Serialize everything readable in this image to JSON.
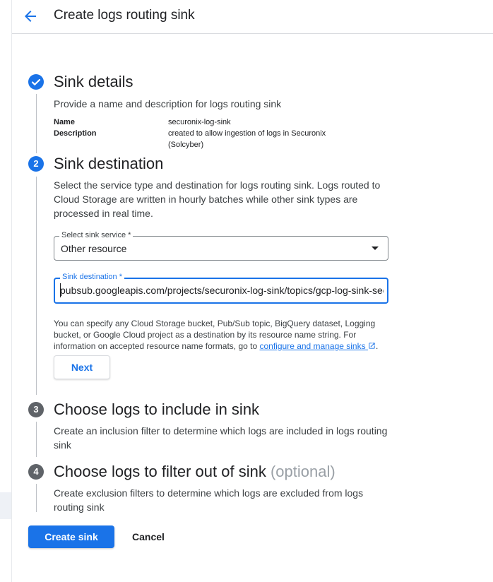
{
  "header": {
    "title": "Create logs routing sink",
    "back_icon": "arrow-back-icon"
  },
  "colors": {
    "accent": "#1a73e8",
    "inactive_step": "#5f6368"
  },
  "steps": [
    {
      "number": "1",
      "state": "done",
      "title": "Sink details",
      "description": "Provide a name and description for logs routing sink",
      "details": [
        {
          "label": "Name",
          "value": "securonix-log-sink"
        },
        {
          "label": "Description",
          "value": "created to allow ingestion of logs in Securonix (Solcyber)"
        }
      ]
    },
    {
      "number": "2",
      "state": "active",
      "title": "Sink destination",
      "description": "Select the service type and destination for logs routing sink. Logs routed to Cloud Storage are written in hourly batches while other sink types are processed in real time.",
      "select_service": {
        "label": "Select sink service *",
        "value": "Other resource"
      },
      "destination": {
        "label": "Sink destination *",
        "value": "pubsub.googleapis.com/projects/securonix-log-sink/topics/gcp-log-sink-securonix"
      },
      "help_text": "You can specify any Cloud Storage bucket, Pub/Sub topic, BigQuery dataset, Logging bucket, or Google Cloud project as a destination by its resource name string. For information on accepted resource name formats, go to",
      "help_link": "configure and manage sinks",
      "help_suffix": ".",
      "next_label": "Next"
    },
    {
      "number": "3",
      "state": "inactive",
      "title": "Choose logs to include in sink",
      "description": "Create an inclusion filter to determine which logs are included in logs routing sink"
    },
    {
      "number": "4",
      "state": "inactive",
      "title": "Choose logs to filter out of sink",
      "optional": "(optional)",
      "description": "Create exclusion filters to determine which logs are excluded from logs routing sink"
    }
  ],
  "actions": {
    "create_label": "Create sink",
    "cancel_label": "Cancel"
  }
}
